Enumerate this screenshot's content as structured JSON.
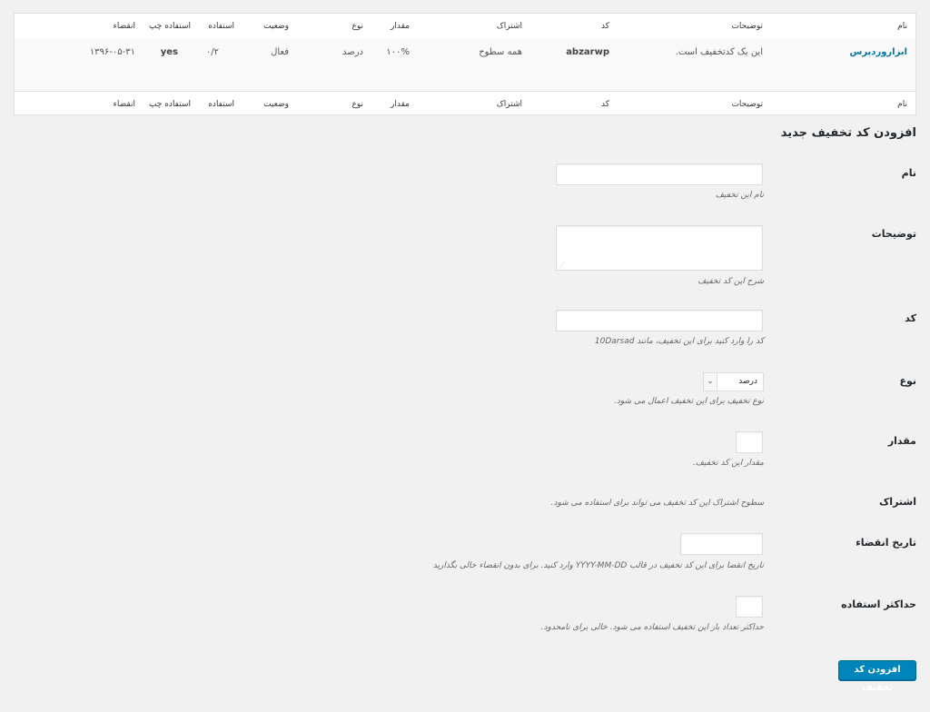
{
  "table": {
    "headers": {
      "name": "نام",
      "description": "توضیحات",
      "code": "کد",
      "membership": "اشتراک",
      "amount": "مقدار",
      "type": "نوع",
      "status": "وضعیت",
      "uses": "استفاده",
      "uses_left": "استفاده چپ",
      "expiry": "انقضاء"
    },
    "row": {
      "name": "ابزاروردپرس",
      "description": "این یک کدتخفیف است.",
      "code": "abzarwp",
      "membership": "همه سطوح",
      "amount": "۱۰۰%",
      "type": "درصد",
      "status": "فعال",
      "uses": "۰/۲",
      "uses_left": "yes",
      "expiry": "۱۳۹۶-۰۵-۳۱"
    }
  },
  "form": {
    "title": "افزودن کد تخفیف جدید",
    "name_label": "نام",
    "name_desc": "نام این تخفیف",
    "description_label": "توضیحات",
    "description_desc": "شرح این کد تخفیف",
    "code_label": "کد",
    "code_desc": "کد را وارد کنید برای این تخفیف، مانند 10Darsad",
    "type_label": "نوع",
    "type_selected": "درصد",
    "type_desc": "نوع تخفیف برای این تخفیف اعمال می شود.",
    "amount_label": "مقدار",
    "amount_desc": "مقدار این کد تخفیف.",
    "membership_label": "اشتراک",
    "membership_desc": "سطوح اشتراک این کد تخفیف می تواند برای استفاده می شود.",
    "expiry_label": "تاریخ انقضاء",
    "expiry_desc": "تاریخ انقضا برای این کد تخفیف در قالب YYYY-MM-DD وارد کنید. برای بدون انقضاء خالی بگذارید",
    "max_uses_label": "حداکثر استفاده",
    "max_uses_desc": "حداکثر تعداد بار این تخفیف استفاده می شود. خالی برای نامحدود.",
    "submit_label": "افزودن کد تخفیف"
  }
}
